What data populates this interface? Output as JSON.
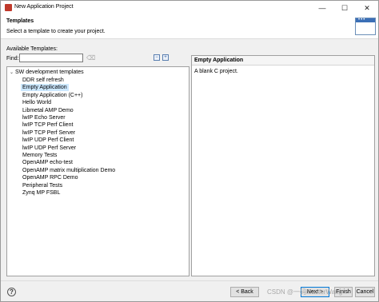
{
  "window": {
    "title": "New Application Project",
    "controls": {
      "minimize": "—",
      "maximize": "☐",
      "close": "✕"
    }
  },
  "header": {
    "title": "Templates",
    "description": "Select a template to create your project."
  },
  "left": {
    "available_label": "Available Templates:",
    "find_label": "Find:",
    "find_value": "",
    "tree": {
      "root_label": "SW development templates",
      "items": [
        {
          "label": "DDR self refresh",
          "selected": false
        },
        {
          "label": "Empty Application",
          "selected": true
        },
        {
          "label": "Empty Application (C++)",
          "selected": false
        },
        {
          "label": "Hello World",
          "selected": false
        },
        {
          "label": "Libmetal AMP Demo",
          "selected": false
        },
        {
          "label": "lwIP Echo Server",
          "selected": false
        },
        {
          "label": "lwIP TCP Perf Client",
          "selected": false
        },
        {
          "label": "lwIP TCP Perf Server",
          "selected": false
        },
        {
          "label": "lwIP UDP Perf Client",
          "selected": false
        },
        {
          "label": "lwIP UDP Perf Server",
          "selected": false
        },
        {
          "label": "Memory Tests",
          "selected": false
        },
        {
          "label": "OpenAMP echo-test",
          "selected": false
        },
        {
          "label": "OpenAMP matrix multiplication Demo",
          "selected": false
        },
        {
          "label": "OpenAMP RPC Demo",
          "selected": false
        },
        {
          "label": "Peripheral Tests",
          "selected": false
        },
        {
          "label": "Zynq MP FSBL",
          "selected": false
        }
      ]
    }
  },
  "right": {
    "title": "Empty Application",
    "description": "A blank C project."
  },
  "footer": {
    "help": "?",
    "back_label": "< Back",
    "next_label": "Next >",
    "finish_label": "Finish",
    "cancel_label": "Cancel"
  },
  "watermark": "CSDN @一码MasterWang",
  "colors": {
    "selection": "#cce8ff",
    "accent": "#0078d7",
    "window_bg": "#f0f0f0"
  }
}
